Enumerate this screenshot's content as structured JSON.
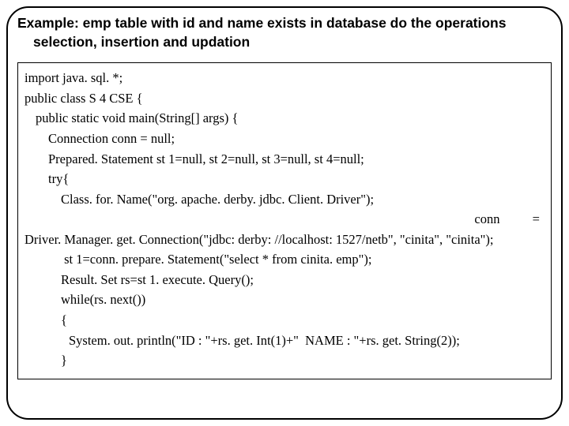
{
  "title": {
    "line1": "Example: emp table with id and name exists in database do the operations",
    "line2": "selection, insertion and updation"
  },
  "code": {
    "l1": "import java. sql. *;",
    "l2": "public class S 4 CSE {",
    "l3": "public static void main(String[] args) {",
    "l4": "Connection conn = null;",
    "l5": "Prepared. Statement st 1=null, st 2=null, st 3=null, st 4=null;",
    "l6": "try{",
    "l7": "Class. for. Name(\"org. apache. derby. jdbc. Client. Driver\");",
    "l8a": "conn",
    "l8b": "=",
    "l9": "Driver. Manager. get. Connection(\"jdbc: derby: //localhost: 1527/netb\", \"cinita\", \"cinita\");",
    "l10": " st 1=conn. prepare. Statement(\"select * from cinita. emp\");",
    "l11": "Result. Set rs=st 1. execute. Query();",
    "l12": "while(rs. next())",
    "l13": "{",
    "l14": "System. out. println(\"ID : \"+rs. get. Int(1)+\"  NAME : \"+rs. get. String(2));",
    "l15": "}"
  }
}
